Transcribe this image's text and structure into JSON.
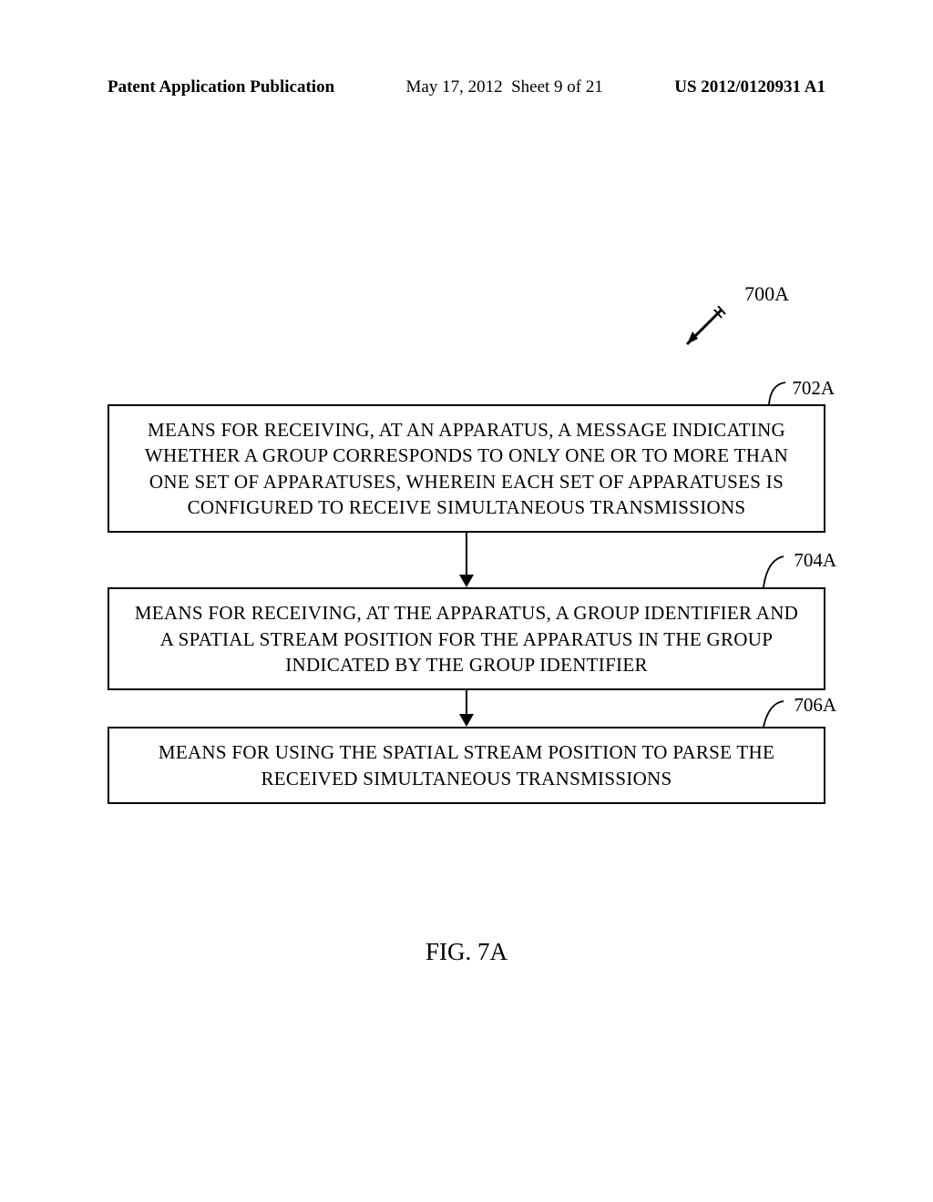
{
  "header": {
    "left": "Patent Application Publication",
    "date": "May 17, 2012",
    "sheet": "Sheet 9 of 21",
    "pubnum": "US 2012/0120931 A1"
  },
  "refs": {
    "r700a": "700A",
    "r702a": "702A",
    "r704a": "704A",
    "r706a": "706A"
  },
  "boxes": {
    "b702a": "MEANS FOR RECEIVING, AT AN APPARATUS, A MESSAGE INDICATING WHETHER A GROUP CORRESPONDS TO ONLY ONE OR TO MORE THAN ONE SET OF APPARATUSES, WHEREIN EACH SET OF APPARATUSES IS CONFIGURED TO RECEIVE SIMULTANEOUS TRANSMISSIONS",
    "b704a": "MEANS FOR RECEIVING, AT THE APPARATUS, A GROUP IDENTIFIER AND A SPATIAL STREAM POSITION FOR THE APPARATUS IN THE GROUP INDICATED BY THE GROUP IDENTIFIER",
    "b706a": "MEANS FOR USING THE SPATIAL STREAM POSITION TO PARSE THE RECEIVED SIMULTANEOUS TRANSMISSIONS"
  },
  "caption": "FIG. 7A",
  "chart_data": {
    "type": "diagram",
    "kind": "patent-means-flow",
    "title": "FIG. 7A",
    "figure_ref": "700A",
    "nodes": [
      {
        "id": "702A",
        "text": "MEANS FOR RECEIVING, AT AN APPARATUS, A MESSAGE INDICATING WHETHER A GROUP CORRESPONDS TO ONLY ONE OR TO MORE THAN ONE SET OF APPARATUSES, WHEREIN EACH SET OF APPARATUSES IS CONFIGURED TO RECEIVE SIMULTANEOUS TRANSMISSIONS"
      },
      {
        "id": "704A",
        "text": "MEANS FOR RECEIVING, AT THE APPARATUS, A GROUP IDENTIFIER AND A SPATIAL STREAM POSITION FOR THE APPARATUS IN THE GROUP INDICATED BY THE GROUP IDENTIFIER"
      },
      {
        "id": "706A",
        "text": "MEANS FOR USING THE SPATIAL STREAM POSITION TO PARSE THE RECEIVED SIMULTANEOUS TRANSMISSIONS"
      }
    ],
    "edges": [
      {
        "from": "702A",
        "to": "704A"
      },
      {
        "from": "704A",
        "to": "706A"
      }
    ]
  }
}
